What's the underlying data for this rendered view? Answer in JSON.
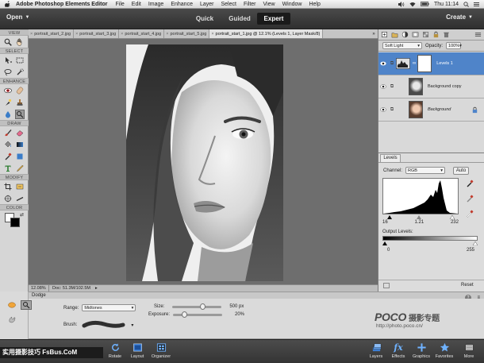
{
  "menubar": {
    "app_name": "Adobe Photoshop Elements Editor",
    "items": [
      "File",
      "Edit",
      "Image",
      "Enhance",
      "Layer",
      "Select",
      "Filter",
      "View",
      "Window",
      "Help"
    ],
    "clock": "Thu 11:14"
  },
  "topbar": {
    "open_label": "Open",
    "modes": [
      "Quick",
      "Guided",
      "Expert"
    ],
    "active_mode": "Expert",
    "create_label": "Create"
  },
  "toolbox": {
    "sections": [
      "VIEW",
      "SELECT",
      "ENHANCE",
      "DRAW",
      "MODIFY",
      "COLOR"
    ]
  },
  "tabs": [
    "portrait_start_2.jpg",
    "portrait_start_3.jpg",
    "portrait_start_4.jpg",
    "portrait_start_5.jpg",
    "portrait_start_1.jpg @ 12.1% (Levels 1, Layer Mask/8)"
  ],
  "status": {
    "zoom": "12.08%",
    "doc": "Doc: 51.3M/102.5M"
  },
  "layers_panel": {
    "blend_mode": "Soft Light",
    "opacity_label": "Opacity:",
    "opacity_value": "100%",
    "layers": [
      {
        "name": "Levels 1",
        "selected": true
      },
      {
        "name": "Background copy",
        "selected": false
      },
      {
        "name": "Background",
        "selected": false
      }
    ]
  },
  "levels": {
    "tab_label": "Levels",
    "channel_label": "Channel:",
    "channel_value": "RGB",
    "auto_label": "Auto",
    "input_black": "16",
    "input_gamma": "1.21",
    "input_white": "232",
    "output_label": "Output Levels:",
    "output_black": "0",
    "output_white": "255",
    "reset_label": "Reset"
  },
  "tool_options": {
    "tool_name": "Dodge",
    "range_label": "Range:",
    "range_value": "Midtones",
    "brush_label": "Brush:",
    "size_label": "Size:",
    "size_value": "500 px",
    "size_level": 0.63,
    "exposure_label": "Exposure:",
    "exposure_value": "20%",
    "exposure_level": 0.2
  },
  "watermark": {
    "logo_latin": "POCO",
    "logo_cn": "摄影专题",
    "url": "http://photo.poco.cn/"
  },
  "bottom_left_banner": "实用摄影技巧 FsBus.CoM",
  "bottom_bar": {
    "left_items": [
      "Rotate",
      "Layout",
      "Organizer"
    ],
    "right_items": [
      "Layers",
      "Effects",
      "Graphics",
      "Favorites",
      "More"
    ]
  }
}
